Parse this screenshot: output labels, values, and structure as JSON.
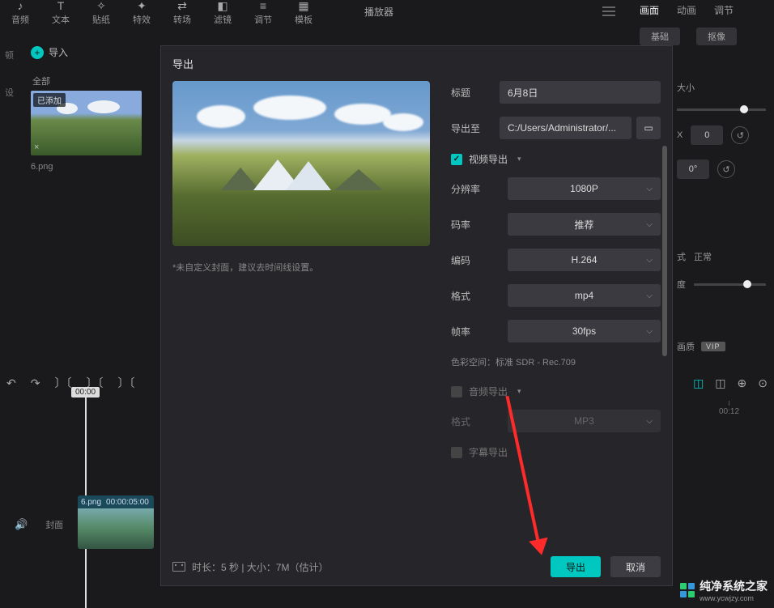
{
  "toolbar": {
    "items": [
      {
        "label": "音频",
        "icon": "♪"
      },
      {
        "label": "文本",
        "icon": "T"
      },
      {
        "label": "贴纸",
        "icon": "✧"
      },
      {
        "label": "特效",
        "icon": "✦"
      },
      {
        "label": "转场",
        "icon": "⇄"
      },
      {
        "label": "滤镜",
        "icon": "◧"
      },
      {
        "label": "调节",
        "icon": "≡"
      },
      {
        "label": "模板",
        "icon": "▦"
      }
    ]
  },
  "player_label": "播放器",
  "right_tabs": [
    "画面",
    "动画",
    "调节"
  ],
  "right_pills": [
    "基础",
    "抠像"
  ],
  "import": {
    "label": "导入",
    "circle": "+"
  },
  "all_label": "全部",
  "thumb": {
    "badge": "已添加",
    "name": "6.png"
  },
  "left_icons": [
    "顿",
    "设"
  ],
  "dialog": {
    "title": "导出",
    "preview_hint": "*未自定义封面，建议去时间线设置。",
    "fields": {
      "title_label": "标题",
      "title_value": "6月8日",
      "exportto_label": "导出至",
      "exportto_value": "C:/Users/Administrator/..."
    },
    "video_section": {
      "head": "视频导出",
      "rows": [
        {
          "label": "分辨率",
          "value": "1080P"
        },
        {
          "label": "码率",
          "value": "推荐"
        },
        {
          "label": "编码",
          "value": "H.264"
        },
        {
          "label": "格式",
          "value": "mp4"
        },
        {
          "label": "帧率",
          "value": "30fps"
        }
      ],
      "colorspace": "色彩空间：标准 SDR - Rec.709"
    },
    "audio_section": {
      "head": "音频导出",
      "row": {
        "label": "格式",
        "value": "MP3"
      }
    },
    "subtitle_section": {
      "head": "字幕导出"
    },
    "footer_info": "时长：5 秒 | 大小：7M（估计）",
    "btn_primary": "导出",
    "btn_secondary": "取消"
  },
  "right_panel": {
    "size_label": "大小",
    "x_label": "X",
    "x_value": "0",
    "deg_value": "0°",
    "mode_label": "式",
    "mode_value": "正常",
    "opacity_label": "度",
    "quality_label": "画质",
    "vip": "VIP"
  },
  "timeline": {
    "playhead_time": "00:00",
    "tick": "00:12"
  },
  "clip": {
    "name": "6.png",
    "time": "00:00:05:00"
  },
  "cover_label": "封面",
  "watermark": {
    "name": "纯净系统之家",
    "url": "www.ycwjzy.com"
  }
}
